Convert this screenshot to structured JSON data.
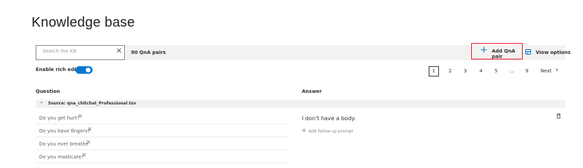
{
  "page": {
    "title": "Knowledge base"
  },
  "toolbar": {
    "search_placeholder": "Search the KB",
    "qna_count": "90 QnA pairs",
    "add_label": "Add QnA pair",
    "view_label": "View options"
  },
  "editor": {
    "rich_label": "Enable rich editor",
    "rich_enabled": true
  },
  "pagination": {
    "pages": [
      "1",
      "2",
      "3",
      "4",
      "5",
      "...",
      "9"
    ],
    "current": "1",
    "next_label": "Next"
  },
  "columns": {
    "question": "Question",
    "answer": "Answer"
  },
  "source": {
    "label": "Source: qna_chitchat_Professional.tsv"
  },
  "questions": [
    "Do you get hurt?",
    "Do you have fingers?",
    "Do you ever breathe",
    "Do you masticate?"
  ],
  "answer": {
    "text": "I don't have a body.",
    "follow_up": "Add follow-up prompt"
  },
  "colors": {
    "accent": "#0078d4",
    "highlight": "#e81123"
  }
}
